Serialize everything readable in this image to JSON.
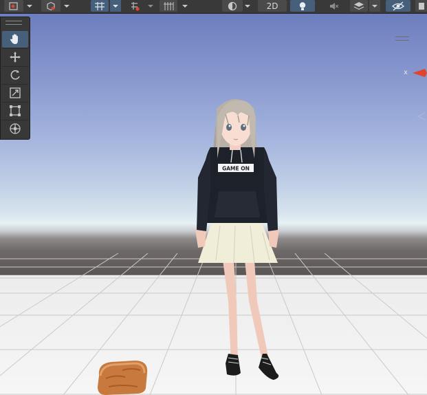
{
  "toolbar": {
    "mode_2d_label": "2D",
    "icons": [
      "pivot-icon",
      "draw-mode-icon",
      "snap-increment-icon",
      "grid-snap-icon",
      "grid-visibility-icon",
      "shading-mode-icon",
      "mode-2d",
      "lighting-icon",
      "audio-mute-icon",
      "effects-icon",
      "visibility-icon",
      "gizmos-icon"
    ]
  },
  "tools_panel": {
    "items": [
      "hand-tool",
      "move-tool",
      "rotate-tool",
      "scale-tool",
      "rect-tool",
      "transform-tool"
    ],
    "active": "hand-tool"
  },
  "scene_gizmo": {
    "axis_label": "x",
    "axis_color": "#e0452f"
  },
  "scene": {
    "character_hoodie_text": "GAME ON",
    "objects": [
      "anime-girl-character",
      "bread-loaf"
    ]
  },
  "colors": {
    "accent_active": "#46607c",
    "toolbar_bg": "#393939",
    "panel_bg": "#383838"
  }
}
